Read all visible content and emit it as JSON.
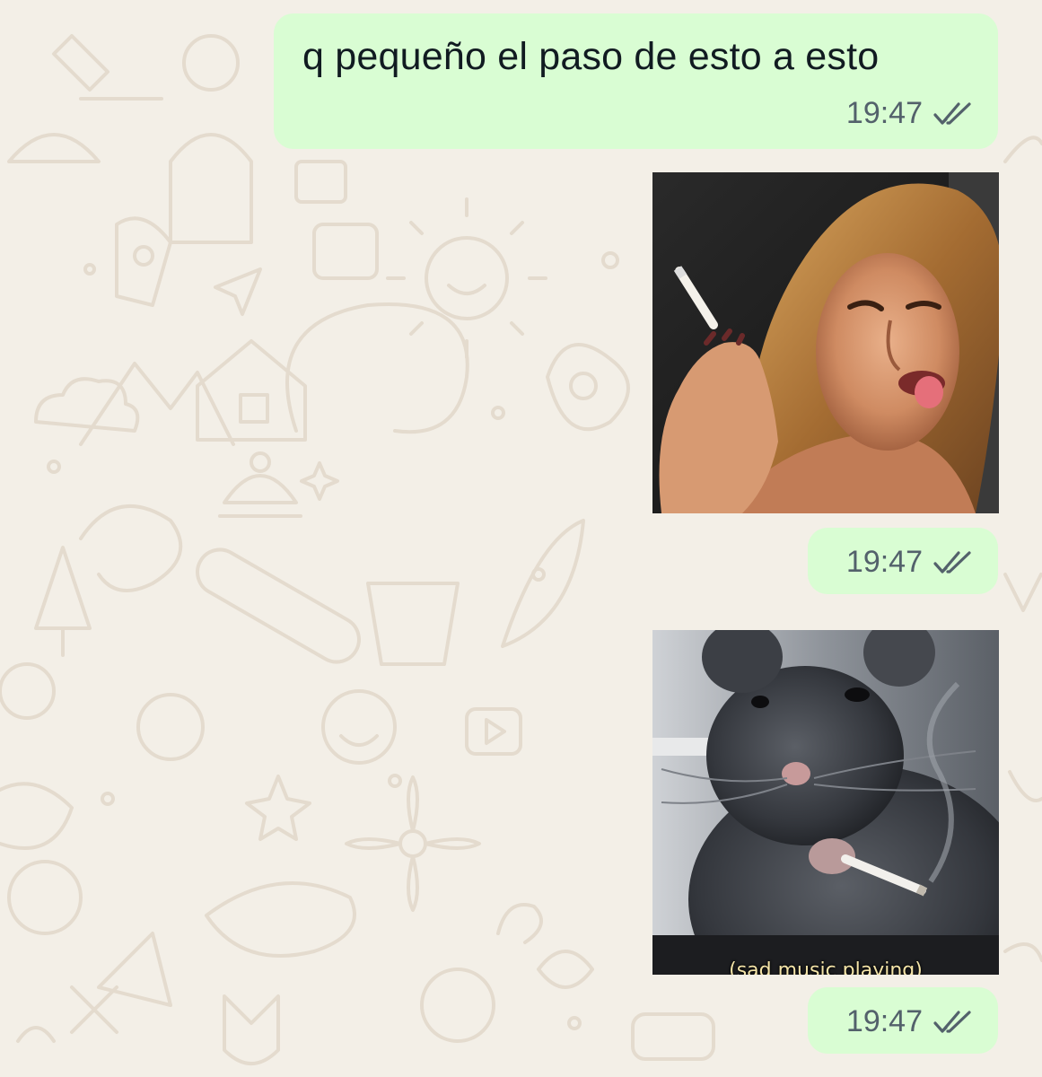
{
  "messages": [
    {
      "type": "text",
      "text": "q pequeño el paso de esto a esto",
      "time": "19:47",
      "status_icon": "double-check-icon"
    },
    {
      "type": "image",
      "image_subject": "woman smoking cigarette sticking out tongue",
      "time": "19:47",
      "status_icon": "double-check-icon"
    },
    {
      "type": "image",
      "image_subject": "rat holding cigarette",
      "caption": "(sad music playing)",
      "time": "19:47",
      "status_icon": "double-check-icon"
    }
  ],
  "colors": {
    "wallpaper": "#f3efe7",
    "wallpaper_doodle": "#e6ddd0",
    "outgoing_bubble": "#d9fdd3",
    "timestamp": "#53616b",
    "read_ticks": "#53616b"
  }
}
